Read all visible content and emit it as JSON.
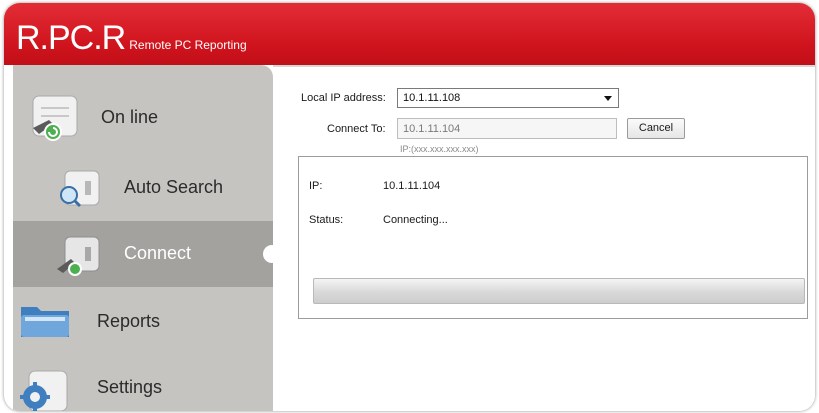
{
  "app": {
    "logo_main": "R.PC.R",
    "logo_sub": "Remote PC Reporting",
    "accent_color": "#d0141e",
    "sidebar_color": "#c6c4c1",
    "active_item_color": "#a4a29f"
  },
  "sidebar": {
    "items": [
      {
        "label": "On line",
        "icon": "network-connection-icon",
        "active": false
      },
      {
        "label": "Auto Search",
        "icon": "magnifier-search-icon",
        "active": false
      },
      {
        "label": "Connect",
        "icon": "connect-plug-icon",
        "active": true
      },
      {
        "label": "Reports",
        "icon": "folder-icon",
        "active": false
      },
      {
        "label": "Settings",
        "icon": "gear-icon",
        "active": false
      }
    ]
  },
  "form": {
    "local_ip_label": "Local IP address:",
    "local_ip_value": "10.1.11.108",
    "connect_to_label": "Connect To:",
    "connect_to_value": "10.1.11.104",
    "cancel_label": "Cancel",
    "ip_hint": "IP:(xxx.xxx.xxx.xxx)"
  },
  "status": {
    "ip_label": "IP:",
    "ip_value": "10.1.11.104",
    "status_label": "Status:",
    "status_value": "Connecting...",
    "progress": 0
  }
}
